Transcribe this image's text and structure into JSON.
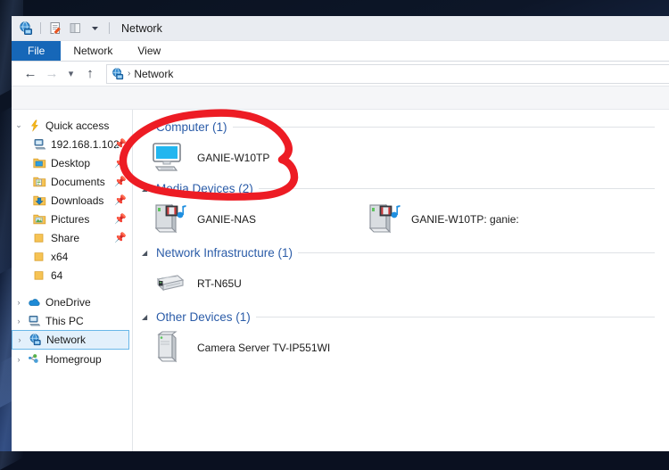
{
  "window": {
    "title": "Network",
    "titlebar_icons": [
      "network-globe-icon",
      "properties-icon",
      "new-folder-icon",
      "customize-chevron-icon"
    ]
  },
  "ribbon": {
    "tabs": [
      {
        "label": "File",
        "active": true
      },
      {
        "label": "Network",
        "active": false
      },
      {
        "label": "View",
        "active": false
      }
    ]
  },
  "addressbar": {
    "back_icon": "back-arrow-icon",
    "forward_icon": "forward-arrow-icon",
    "recent_icon": "recent-locations-chevron-icon",
    "up_icon": "up-arrow-icon",
    "location_icon": "network-globe-icon",
    "separator": "›",
    "crumb": "Network"
  },
  "sidebar": {
    "items": [
      {
        "label": "Quick access",
        "icon": "quick-access-star-icon",
        "chevron": "⌄",
        "indent": false,
        "pin": false,
        "selected": false
      },
      {
        "label": "192.168.1.102",
        "icon": "computer-icon",
        "chevron": "",
        "indent": true,
        "pin": true,
        "selected": false
      },
      {
        "label": "Desktop",
        "icon": "desktop-folder-icon",
        "chevron": "",
        "indent": true,
        "pin": true,
        "selected": false
      },
      {
        "label": "Documents",
        "icon": "documents-folder-icon",
        "chevron": "",
        "indent": true,
        "pin": true,
        "selected": false
      },
      {
        "label": "Downloads",
        "icon": "downloads-folder-icon",
        "chevron": "",
        "indent": true,
        "pin": true,
        "selected": false
      },
      {
        "label": "Pictures",
        "icon": "pictures-folder-icon",
        "chevron": "",
        "indent": true,
        "pin": true,
        "selected": false
      },
      {
        "label": "Share",
        "icon": "folder-icon",
        "chevron": "",
        "indent": true,
        "pin": true,
        "selected": false
      },
      {
        "label": "x64",
        "icon": "folder-icon",
        "chevron": "",
        "indent": true,
        "pin": false,
        "selected": false
      },
      {
        "label": "64",
        "icon": "folder-icon",
        "chevron": "",
        "indent": true,
        "pin": false,
        "selected": false
      },
      {
        "label": "OneDrive",
        "icon": "onedrive-cloud-icon",
        "chevron": "›",
        "indent": false,
        "pin": false,
        "selected": false,
        "gap": true
      },
      {
        "label": "This PC",
        "icon": "this-pc-icon",
        "chevron": "›",
        "indent": false,
        "pin": false,
        "selected": false
      },
      {
        "label": "Network",
        "icon": "network-globe-icon",
        "chevron": "›",
        "indent": false,
        "pin": false,
        "selected": true
      },
      {
        "label": "Homegroup",
        "icon": "homegroup-icon",
        "chevron": "›",
        "indent": false,
        "pin": false,
        "selected": false
      }
    ]
  },
  "content": {
    "groups": [
      {
        "title": "Computer (1)",
        "chevron": "◢",
        "items": [
          {
            "name": "GANIE-W10TP",
            "icon": "computer-monitor-icon"
          }
        ]
      },
      {
        "title": "Media Devices (2)",
        "chevron": "◢",
        "items": [
          {
            "name": "GANIE-NAS",
            "icon": "media-server-icon"
          },
          {
            "name": "GANIE-W10TP: ganie:",
            "icon": "media-server-icon"
          }
        ]
      },
      {
        "title": "Network Infrastructure (1)",
        "chevron": "◢",
        "items": [
          {
            "name": "RT-N65U",
            "icon": "router-icon"
          }
        ]
      },
      {
        "title": "Other Devices (1)",
        "chevron": "◢",
        "items": [
          {
            "name": "Camera Server TV-IP551WI",
            "icon": "server-tower-icon"
          }
        ]
      }
    ]
  },
  "annotation": {
    "type": "hand-drawn-circle",
    "color": "#ed1c24",
    "target": "GANIE-W10TP under Computer (1)"
  },
  "colors": {
    "accent_blue": "#1667b8",
    "group_header": "#2b5ca8",
    "selection_bg": "#e2f0fb",
    "selection_border": "#69b7e8",
    "annotation_red": "#ed1c24"
  }
}
